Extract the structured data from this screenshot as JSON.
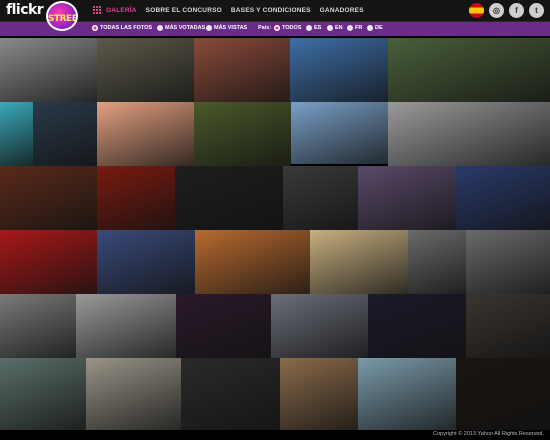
{
  "header": {
    "logo": "flickr",
    "badge": {
      "top": "",
      "main": "STREET",
      "sub": ""
    },
    "nav": [
      {
        "label": "GALERÍA",
        "active": true
      },
      {
        "label": "SOBRE EL CONCURSO",
        "active": false
      },
      {
        "label": "BASES Y CONDICIONES",
        "active": false
      },
      {
        "label": "GANADORES",
        "active": false
      }
    ],
    "social": [
      {
        "name": "spain-flag-icon",
        "glyph": ""
      },
      {
        "name": "instagram-icon",
        "glyph": "◎"
      },
      {
        "name": "facebook-icon",
        "glyph": "f"
      },
      {
        "name": "twitter-icon",
        "glyph": "t"
      }
    ]
  },
  "filters": {
    "sort": [
      {
        "label": "TODAS LAS FOTOS",
        "selected": true
      },
      {
        "label": "MÁS VOTADAS",
        "selected": false
      },
      {
        "label": "MÁS VISTAS",
        "selected": false
      }
    ],
    "lang_label": "País:",
    "lang": [
      {
        "label": "TODOS",
        "selected": true
      },
      {
        "label": "ES",
        "selected": false
      },
      {
        "label": "EN",
        "selected": false
      },
      {
        "label": "FR",
        "selected": false
      },
      {
        "label": "DE",
        "selected": false
      }
    ]
  },
  "photos": [
    {
      "name": "photo-greek-temple",
      "bg": "#8a8a8a"
    },
    {
      "name": "photo-cat-eye",
      "bg": "#5c5a4a"
    },
    {
      "name": "photo-graffiti-amor",
      "bg": "#8a4a3a"
    },
    {
      "name": "photo-shoes-on-wire",
      "bg": "#3e6fa8"
    },
    {
      "name": "photo-basketball-hoop",
      "bg": "#4a5f3a"
    },
    {
      "name": "photo-teal-sculpture",
      "bg": "#3aa8b8"
    },
    {
      "name": "photo-dark-structure",
      "bg": "#2a3a4a"
    },
    {
      "name": "photo-sunset-figure",
      "bg": "#e4a080"
    },
    {
      "name": "photo-garden",
      "bg": "#4a5a2a"
    },
    {
      "name": "photo-palace-lake",
      "bg": "#7aa0c8"
    },
    {
      "name": "photo-old-men-bench",
      "bg": "#9a9a9a"
    },
    {
      "name": "photo-night-crowd",
      "bg": "#5a2a1a"
    },
    {
      "name": "photo-chinese-lanterns",
      "bg": "#7a1a10"
    },
    {
      "name": "photo-newspaper-readers",
      "bg": "#1e1e1e"
    },
    {
      "name": "photo-market-stalls",
      "bg": "#3a3a3a"
    },
    {
      "name": "photo-neon-interior",
      "bg": "#5a4a6a"
    },
    {
      "name": "photo-river-bridge-dusk",
      "bg": "#2a3a6a"
    },
    {
      "name": "photo-red-seats",
      "bg": "#a81818"
    },
    {
      "name": "photo-harbor-dusk",
      "bg": "#3a4a7a"
    },
    {
      "name": "photo-stage-hall",
      "bg": "#b86a30"
    },
    {
      "name": "photo-street-market",
      "bg": "#c8b080"
    },
    {
      "name": "photo-street-vendor",
      "bg": "#6a6a6a"
    },
    {
      "name": "photo-bw-street-sign",
      "bg": "#6a6a6a"
    },
    {
      "name": "photo-red-flag-runner",
      "bg": "#7a7a7a"
    },
    {
      "name": "photo-river-forest",
      "bg": "#9a9a9a"
    },
    {
      "name": "photo-fireworks",
      "bg": "#2a1a2a"
    },
    {
      "name": "photo-lake-city",
      "bg": "#6a6e78"
    },
    {
      "name": "photo-night-skyline",
      "bg": "#1a1a2a"
    },
    {
      "name": "photo-modern-building",
      "bg": "#3a3530"
    },
    {
      "name": "photo-aerial-landscape",
      "bg": "#5a6e6a"
    },
    {
      "name": "photo-boat-on-sand",
      "bg": "#9a9488"
    },
    {
      "name": "photo-night-street-lamp",
      "bg": "#2a2a2a"
    },
    {
      "name": "photo-balcony-plants",
      "bg": "#8a6a4a"
    },
    {
      "name": "photo-statue-head",
      "bg": "#7a9aaa"
    },
    {
      "name": "photo-night-tower",
      "bg": "#1a1410"
    }
  ],
  "footer": {
    "copyright": "Copyright © 2013 Yahoo All Rights Reserved."
  }
}
